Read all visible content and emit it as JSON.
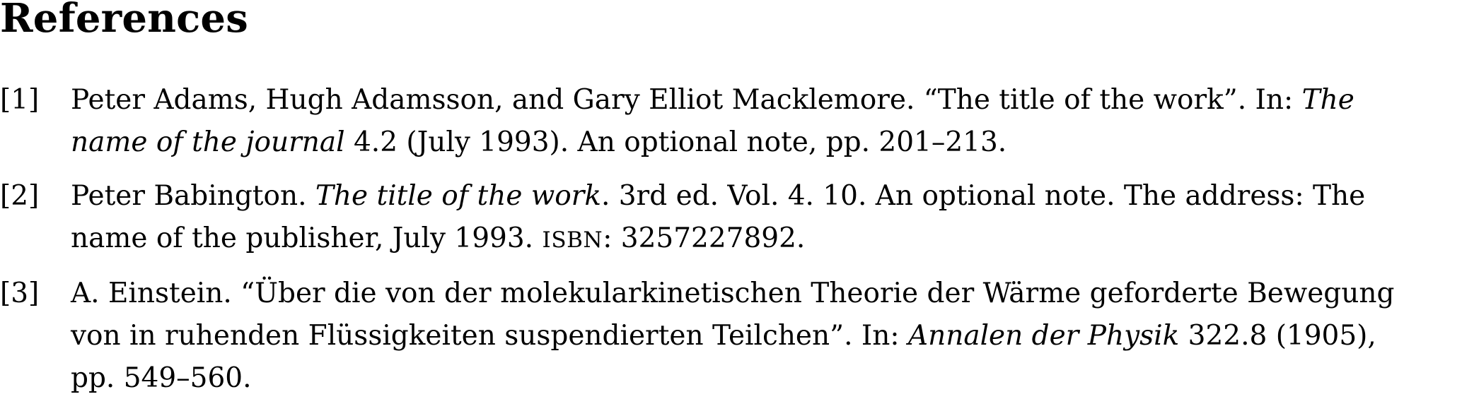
{
  "references": {
    "heading": "References",
    "entries": [
      {
        "label": "[1]",
        "line1": {
          "a": "Peter Adams, Hugh Adamsson, and Gary Elliot Macklemore. “The title of the work”. In: ",
          "b": "The"
        },
        "line2": {
          "a": "name of the journal",
          "b": " 4.2 (July 1993). An optional note, pp. 201–213."
        }
      },
      {
        "label": "[2]",
        "line1": {
          "a": "Peter Babington. ",
          "b": "The title of the work",
          "c": ". 3rd ed. Vol. 4. 10. An optional note. The address: The"
        },
        "line2": {
          "a": "name of the publisher, July 1993. ",
          "b": "ISBN",
          "c": ": 3257227892."
        }
      },
      {
        "label": "[3]",
        "line1": {
          "a": "A. Einstein. “Über die von der molekularkinetischen Theorie der Wärme geforderte Bewegung"
        },
        "line2": {
          "a": "von in ruhenden Flüssigkeiten suspendierten Teilchen”. In: ",
          "b": "Annalen der Physik",
          "c": " 322.8 (1905),"
        },
        "line3": {
          "a": "pp. 549–560."
        }
      }
    ]
  }
}
